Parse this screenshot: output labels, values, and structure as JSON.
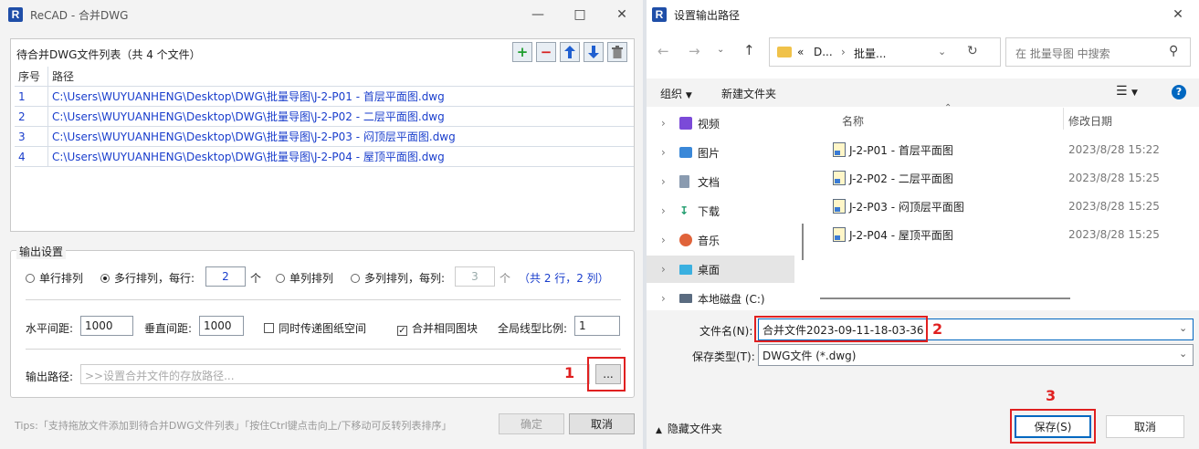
{
  "left_window": {
    "title": "ReCAD - 合并DWG",
    "list_header": "待合并DWG文件列表（共 4 个文件）",
    "columns": [
      "序号",
      "路径"
    ],
    "files": [
      {
        "no": "1",
        "path": "C:\\Users\\WUYUANHENG\\Desktop\\DWG\\批量导图\\J-2-P01 - 首层平面图.dwg"
      },
      {
        "no": "2",
        "path": "C:\\Users\\WUYUANHENG\\Desktop\\DWG\\批量导图\\J-2-P02 - 二层平面图.dwg"
      },
      {
        "no": "3",
        "path": "C:\\Users\\WUYUANHENG\\Desktop\\DWG\\批量导图\\J-2-P03 - 闷顶层平面图.dwg"
      },
      {
        "no": "4",
        "path": "C:\\Users\\WUYUANHENG\\Desktop\\DWG\\批量导图\\J-2-P04 - 屋顶平面图.dwg"
      }
    ],
    "output_settings": {
      "legend": "输出设置",
      "single_row": "单行排列",
      "multi_row": "多行排列，每行:",
      "per_row_value": "2",
      "unit_ge1": "个",
      "single_col": "单列排列",
      "multi_col": "多列排列，每列:",
      "per_col_value": "3",
      "unit_ge2": "个",
      "summary": "（共 2 行，2 列）",
      "h_gap_label": "水平间距:",
      "h_gap_value": "1000",
      "v_gap_label": "垂直间距:",
      "v_gap_value": "1000",
      "sync_space": "同时传递图纸空间",
      "merge_blocks": "合并相同图块",
      "linescale_label": "全局线型比例:",
      "linescale_value": "1",
      "path_label": "输出路径:",
      "path_placeholder": ">>设置合并文件的存放路径...",
      "browse": "..."
    },
    "tips": "Tips:「支持拖放文件添加到待合并DWG文件列表」「按住Ctrl键点击向上/下移动可反转列表排序」",
    "ok": "确定",
    "cancel": "取消",
    "annotation_1": "1"
  },
  "right_window": {
    "title": "设置输出路径",
    "breadcrumb_prefix": "«",
    "breadcrumb_1": "D...",
    "breadcrumb_2": "批量...",
    "search_placeholder": "在 批量导图 中搜索",
    "organize": "组织",
    "new_folder": "新建文件夹",
    "nav": [
      "视频",
      "图片",
      "文档",
      "下载",
      "音乐",
      "桌面",
      "本地磁盘 (C:)"
    ],
    "col_name": "名称",
    "col_date": "修改日期",
    "files": [
      {
        "name": "J-2-P01 - 首层平面图",
        "date": "2023/8/28 15:22"
      },
      {
        "name": "J-2-P02 - 二层平面图",
        "date": "2023/8/28 15:25"
      },
      {
        "name": "J-2-P03 - 闷顶层平面图",
        "date": "2023/8/28 15:25"
      },
      {
        "name": "J-2-P04 - 屋顶平面图",
        "date": "2023/8/28 15:25"
      }
    ],
    "filename_label": "文件名(N):",
    "filename_value": "合并文件2023-09-11-18-03-36",
    "type_label": "保存类型(T):",
    "type_value": "DWG文件 (*.dwg)",
    "hide_folders": "隐藏文件夹",
    "save": "保存(S)",
    "cancel": "取消",
    "annotation_2": "2",
    "annotation_3": "3"
  },
  "colors": {
    "annotation": "#e02020",
    "link_blue": "#1a3ecc",
    "accent": "#0067c0"
  }
}
